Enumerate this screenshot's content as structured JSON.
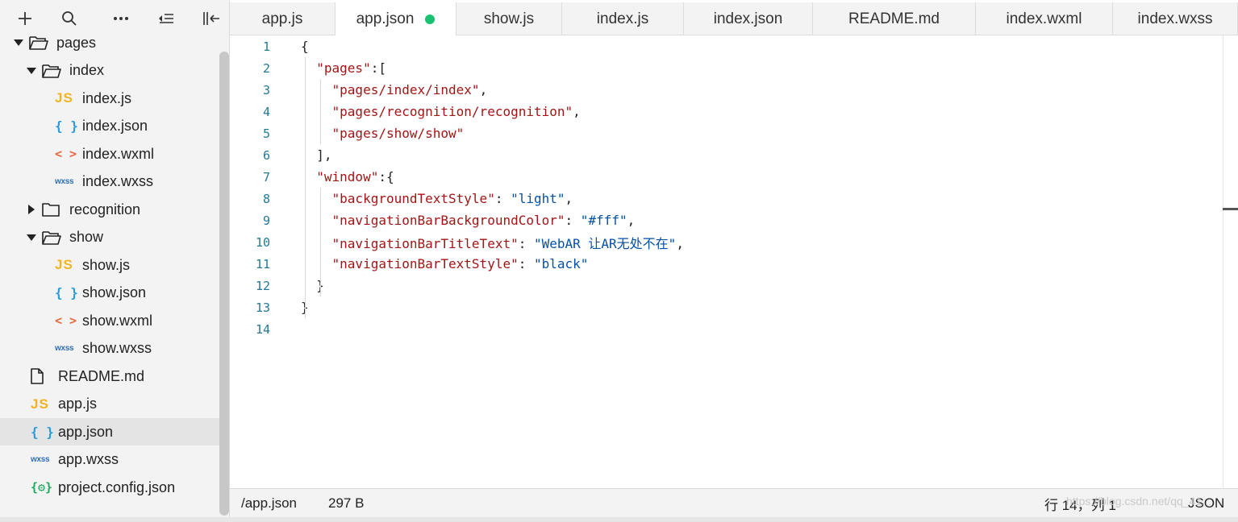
{
  "toolbar": {
    "add": "plus-icon",
    "search": "search-icon",
    "more": "more-icon",
    "collapse": "collapse-list-icon",
    "toggle": "toggle-sidebar-icon"
  },
  "tree": [
    {
      "label": "pages",
      "type": "folder",
      "expanded": true,
      "depth": 0
    },
    {
      "label": "index",
      "type": "folder",
      "expanded": true,
      "depth": 1
    },
    {
      "label": "index.js",
      "type": "js",
      "depth": 2
    },
    {
      "label": "index.json",
      "type": "json",
      "depth": 2
    },
    {
      "label": "index.wxml",
      "type": "wxml",
      "depth": 2
    },
    {
      "label": "index.wxss",
      "type": "wxss",
      "depth": 2
    },
    {
      "label": "recognition",
      "type": "folder",
      "expanded": false,
      "depth": 1
    },
    {
      "label": "show",
      "type": "folder",
      "expanded": true,
      "depth": 1
    },
    {
      "label": "show.js",
      "type": "js",
      "depth": 2
    },
    {
      "label": "show.json",
      "type": "json",
      "depth": 2
    },
    {
      "label": "show.wxml",
      "type": "wxml",
      "depth": 2
    },
    {
      "label": "show.wxss",
      "type": "wxss",
      "depth": 2
    },
    {
      "label": "README.md",
      "type": "file",
      "depth": 0
    },
    {
      "label": "app.js",
      "type": "js",
      "depth": 0
    },
    {
      "label": "app.json",
      "type": "json",
      "depth": 0,
      "selected": true
    },
    {
      "label": "app.wxss",
      "type": "wxss",
      "depth": 0
    },
    {
      "label": "project.config.json",
      "type": "config",
      "depth": 0
    }
  ],
  "icons": {
    "js": "JS",
    "json": "{ }",
    "wxml": "< >",
    "wxss": "wxss",
    "config": "{⚙}"
  },
  "tabs": [
    {
      "label": "app.js"
    },
    {
      "label": "app.json",
      "active": true,
      "modified": true
    },
    {
      "label": "show.js"
    },
    {
      "label": "index.js"
    },
    {
      "label": "index.json"
    },
    {
      "label": "README.md"
    },
    {
      "label": "index.wxml"
    },
    {
      "label": "index.wxss"
    }
  ],
  "editor": {
    "lines": [
      {
        "n": "1",
        "parts": [
          [
            "p",
            "{"
          ]
        ]
      },
      {
        "n": "2",
        "parts": [
          [
            "p",
            "  "
          ],
          [
            "k",
            "\"pages\""
          ],
          [
            "p",
            ":["
          ]
        ]
      },
      {
        "n": "3",
        "parts": [
          [
            "p",
            "    "
          ],
          [
            "k",
            "\"pages/index/index\""
          ],
          [
            "p",
            ","
          ]
        ]
      },
      {
        "n": "4",
        "parts": [
          [
            "p",
            "    "
          ],
          [
            "k",
            "\"pages/recognition/recognition\""
          ],
          [
            "p",
            ","
          ]
        ]
      },
      {
        "n": "5",
        "parts": [
          [
            "p",
            "    "
          ],
          [
            "k",
            "\"pages/show/show\""
          ]
        ]
      },
      {
        "n": "6",
        "parts": [
          [
            "p",
            "  ],"
          ]
        ]
      },
      {
        "n": "7",
        "parts": [
          [
            "p",
            "  "
          ],
          [
            "k",
            "\"window\""
          ],
          [
            "p",
            ":{"
          ]
        ]
      },
      {
        "n": "8",
        "parts": [
          [
            "p",
            "    "
          ],
          [
            "k",
            "\"backgroundTextStyle\""
          ],
          [
            "p",
            ": "
          ],
          [
            "s",
            "\"light\""
          ],
          [
            "p",
            ","
          ]
        ]
      },
      {
        "n": "9",
        "parts": [
          [
            "p",
            "    "
          ],
          [
            "k",
            "\"navigationBarBackgroundColor\""
          ],
          [
            "p",
            ": "
          ],
          [
            "s",
            "\"#fff\""
          ],
          [
            "p",
            ","
          ]
        ]
      },
      {
        "n": "10",
        "parts": [
          [
            "p",
            "    "
          ],
          [
            "k",
            "\"navigationBarTitleText\""
          ],
          [
            "p",
            ": "
          ],
          [
            "s",
            "\"WebAR 让AR无处不在\""
          ],
          [
            "p",
            ","
          ]
        ]
      },
      {
        "n": "11",
        "parts": [
          [
            "p",
            "    "
          ],
          [
            "k",
            "\"navigationBarTextStyle\""
          ],
          [
            "p",
            ": "
          ],
          [
            "s",
            "\"black\""
          ]
        ]
      },
      {
        "n": "12",
        "parts": [
          [
            "p",
            "  }"
          ]
        ]
      },
      {
        "n": "13",
        "parts": [
          [
            "p",
            "}"
          ]
        ]
      },
      {
        "n": "14",
        "parts": []
      }
    ]
  },
  "status": {
    "path": "/app.json",
    "size": "297 B",
    "cursor": "行 14，列 1",
    "language": "JSON",
    "watermark": "https://blog.csdn.net/qq_41..."
  },
  "colors": {
    "key": "#a31515",
    "string": "#0451a5",
    "line_number": "#237893",
    "modified_dot": "#1ac172"
  }
}
